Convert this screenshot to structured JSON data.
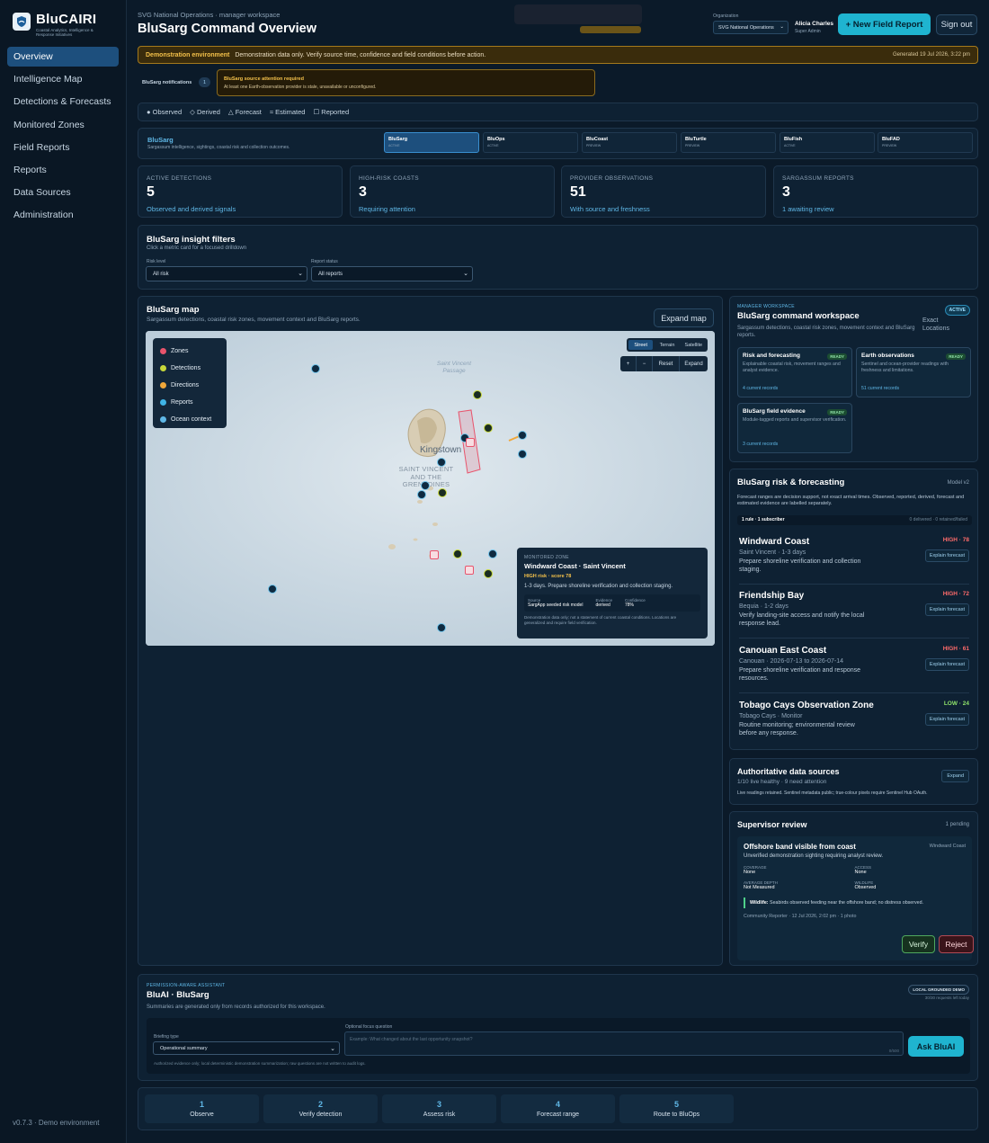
{
  "brand": {
    "name": "BluCAIRI",
    "tagline": "Coastal Analytics, Intelligence & Response Initiatives"
  },
  "nav": [
    {
      "label": "Overview",
      "active": true
    },
    {
      "label": "Intelligence Map"
    },
    {
      "label": "Detections & Forecasts"
    },
    {
      "label": "Monitored Zones"
    },
    {
      "label": "Field Reports"
    },
    {
      "label": "Reports"
    },
    {
      "label": "Data Sources"
    },
    {
      "label": "Administration"
    }
  ],
  "version": "v0.7.3 · Demo environment",
  "header": {
    "breadcrumb": "SVG National Operations · manager workspace",
    "title": "BluSarg Command Overview",
    "org_label": "Organization",
    "org_value": "SVG National Operations",
    "user_name": "Alicia Charles",
    "user_role": "Super Admin",
    "new_report": "+ New Field Report",
    "sign_out": "Sign out"
  },
  "banner": {
    "label": "Demonstration environment",
    "text": "Demonstration data only. Verify source time, confidence and field conditions before action.",
    "generated": "Generated 19 Jul 2026, 3:22 pm"
  },
  "notifications": {
    "label": "BluSarg notifications",
    "count": "1",
    "alert_title": "BluSarg source attention required",
    "alert_body": "At least one Earth-observation provider is stale, unavailable or unconfigured."
  },
  "evidence_types": [
    "Observed",
    "Derived",
    "Forecast",
    "Estimated",
    "Reported"
  ],
  "module": {
    "title": "BluSarg",
    "desc": "Sargassum intelligence, sightings, coastal risk and collection outcomes.",
    "tabs": [
      {
        "name": "BluSarg",
        "status": "ACTIVE",
        "active": true
      },
      {
        "name": "BluOps",
        "status": "ACTIVE"
      },
      {
        "name": "BluCoast",
        "status": "PREVIEW"
      },
      {
        "name": "BluTurtle",
        "status": "PREVIEW"
      },
      {
        "name": "BluFish",
        "status": "ACTIVE"
      },
      {
        "name": "BluFAD",
        "status": "PREVIEW"
      }
    ]
  },
  "metrics": [
    {
      "label": "ACTIVE DETECTIONS",
      "value": "5",
      "sub": "Observed and derived signals"
    },
    {
      "label": "HIGH-RISK COASTS",
      "value": "3",
      "sub": "Requiring attention"
    },
    {
      "label": "PROVIDER OBSERVATIONS",
      "value": "51",
      "sub": "With source and freshness"
    },
    {
      "label": "SARGASSUM REPORTS",
      "value": "3",
      "sub": "1 awaiting review"
    }
  ],
  "filters": {
    "title": "BluSarg insight filters",
    "hint": "Click a metric card for a focused drilldown",
    "risk_label": "Risk level",
    "risk_value": "All risk",
    "status_label": "Report status",
    "status_value": "All reports"
  },
  "map": {
    "title": "BluSarg map",
    "subtitle": "Sargassum detections, coastal risk zones, movement context and BluSarg reports.",
    "expand_map": "Expand map",
    "modes": [
      "Street",
      "Terrain",
      "Satellite"
    ],
    "controls": [
      "+",
      "−",
      "Reset",
      "Expand"
    ],
    "legend": [
      "Zones",
      "Detections",
      "Directions",
      "Reports",
      "Ocean context"
    ],
    "legend_colors": [
      "#e8546c",
      "#c7d83a",
      "#f0a73a",
      "#3fb4e6",
      "#5fb7e6"
    ],
    "place_labels": [
      "Saint Vincent Passage",
      "Kingstown",
      "SAINT VINCENT AND THE GRENADINES"
    ],
    "popup": {
      "kicker": "MONITORED ZONE",
      "title": "Windward Coast · Saint Vincent",
      "risk": "HIGH risk · score 78",
      "desc": "1-3 days. Prepare shoreline verification and collection staging.",
      "source_label": "Source",
      "source": "SargApp seeded risk model",
      "evidence_label": "Evidence",
      "evidence": "derived",
      "confidence_label": "Confidence",
      "confidence": "78%",
      "note": "Demonstration data only; not a statement of current coastal conditions. Locations are generalized and require field verification."
    }
  },
  "workspace": {
    "kicker": "MANAGER WORKSPACE",
    "title": "BluSarg command workspace",
    "desc": "Sargassum detections, coastal risk zones, movement context and BluSarg reports.",
    "exact": "Exact Locations",
    "badge": "ACTIVE",
    "cards": [
      {
        "title": "Risk and forecasting",
        "status": "READY",
        "body": "Explainable coastal risk, movement ranges and analyst evidence.",
        "link": "4 current records"
      },
      {
        "title": "Earth observations",
        "status": "READY",
        "body": "Sentinel and ocean-provider readings with freshness and limitations.",
        "link": "51 current records"
      },
      {
        "title": "BluSarg field evidence",
        "status": "READY",
        "body": "Module-tagged reports and supervisor verification.",
        "link": "3 current records"
      }
    ]
  },
  "risk": {
    "title": "BluSarg risk & forecasting",
    "model": "Model v2",
    "note": "Forecast ranges are decision support, not exact arrival times. Observed, reported, derived, forecast and estimated evidence are labelled separately.",
    "rule": "1 rule · 1 subscriber",
    "rule_stats": "0 delivered · 0 retained/failed",
    "explain": "Explain forecast",
    "items": [
      {
        "name": "Windward Coast",
        "score": "HIGH · 78",
        "meta": "Saint Vincent · 1-3 days",
        "desc": "Prepare shoreline verification and collection staging.",
        "color": "#ff6b6b"
      },
      {
        "name": "Friendship Bay",
        "score": "HIGH · 72",
        "meta": "Bequia · 1-2 days",
        "desc": "Verify landing-site access and notify the local response lead.",
        "color": "#ff6b6b"
      },
      {
        "name": "Canouan East Coast",
        "score": "HIGH · 61",
        "meta": "Canouan · 2026-07-13 to 2026-07-14",
        "desc": "Prepare shoreline verification and response resources.",
        "color": "#ff6b6b"
      },
      {
        "name": "Tobago Cays Observation Zone",
        "score": "LOW · 24",
        "meta": "Tobago Cays · Monitor",
        "desc": "Routine monitoring; environmental review before any response.",
        "color": "#8fe36b"
      }
    ]
  },
  "sources": {
    "title": "Authoritative data sources",
    "sub": "1/10 live healthy · 9 need attention",
    "note": "Live readings retained. Sentinel metadata public; true-colour pixels require Sentinel Hub OAuth.",
    "expand": "Expand"
  },
  "review": {
    "title": "Supervisor review",
    "pending": "1 pending",
    "item_title": "Offshore band visible from coast",
    "zone": "Windward Coast",
    "desc": "Unverified demonstration sighting requiring analyst review.",
    "fields": [
      {
        "k": "COVERAGE",
        "v": "None"
      },
      {
        "k": "ACCESS",
        "v": "None"
      },
      {
        "k": "AVERAGE DEPTH",
        "v": "Not Measured"
      },
      {
        "k": "WILDLIFE",
        "v": "Observed"
      }
    ],
    "wildlife_label": "Wildlife:",
    "wildlife": "Seabirds observed feeding near the offshore band; no distress observed.",
    "reporter": "Community Reporter · 12 Jul 2026, 2:02 pm · 1 photo",
    "verify": "Verify",
    "reject": "Reject"
  },
  "assistant": {
    "kicker": "PERMISSION-AWARE ASSISTANT",
    "title": "BluAI · BluSarg",
    "desc": "Summaries are generated only from records authorized for this workspace.",
    "badge": "LOCAL GROUNDED DEMO",
    "quota": "30/30 requests left today",
    "briefing_label": "Briefing type",
    "briefing_value": "Operational summary",
    "focus_label": "Optional focus question",
    "focus_placeholder": "Example: What changed about the last opportunity snapshot?",
    "counter": "0/500",
    "ask": "Ask BluAI",
    "footnote": "Authorized evidence only; local deterministic demonstration summarization; raw questions are not written to audit logs."
  },
  "steps": [
    {
      "n": "1",
      "label": "Observe"
    },
    {
      "n": "2",
      "label": "Verify detection"
    },
    {
      "n": "3",
      "label": "Assess risk"
    },
    {
      "n": "4",
      "label": "Forecast range"
    },
    {
      "n": "5",
      "label": "Route to BluOps"
    }
  ]
}
